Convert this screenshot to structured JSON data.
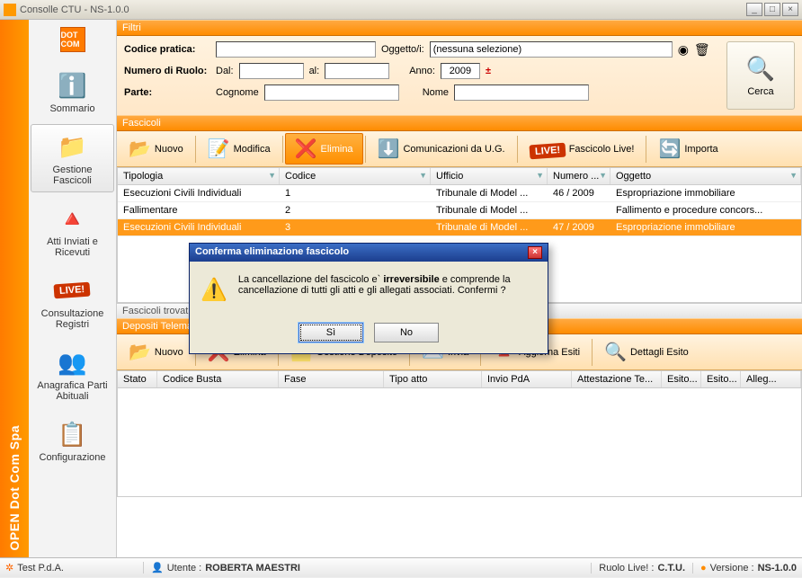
{
  "window": {
    "title": "Consolle CTU - NS-1.0.0"
  },
  "brand": {
    "vertical": "OPEN Dot Com Spa",
    "logo": "DOT COM"
  },
  "sidebar": {
    "items": [
      {
        "label": "Sommario",
        "icon": "ℹ️"
      },
      {
        "label": "Gestione Fascicoli",
        "icon": "📁"
      },
      {
        "label": "Atti Inviati e Ricevuti",
        "icon": "🔺"
      },
      {
        "label": "Consultazione Registri",
        "icon": "LIVE!"
      },
      {
        "label": "Anagrafica Parti Abituali",
        "icon": "👥"
      },
      {
        "label": "Configurazione",
        "icon": "📋"
      }
    ]
  },
  "filters": {
    "title": "Filtri",
    "codice_pratica_label": "Codice pratica:",
    "oggetto_label": "Oggetto/i:",
    "oggetto_value": "(nessuna selezione)",
    "numero_ruolo_label": "Numero di Ruolo:",
    "dal_label": "Dal:",
    "al_label": "al:",
    "anno_label": "Anno:",
    "anno_value": "2009",
    "parte_label": "Parte:",
    "cognome_label": "Cognome",
    "nome_label": "Nome",
    "cerca_label": "Cerca"
  },
  "fascicoli": {
    "title": "Fascicoli",
    "toolbar": [
      {
        "label": "Nuovo",
        "icon": "📂"
      },
      {
        "label": "Modifica",
        "icon": "📝"
      },
      {
        "label": "Elimina",
        "icon": "❌"
      },
      {
        "label": "Comunicazioni da U.G.",
        "icon": "⬇️"
      },
      {
        "label": "Fascicolo Live!",
        "icon": "LIVE!"
      },
      {
        "label": "Importa",
        "icon": "🔄"
      }
    ],
    "columns": [
      "Tipologia",
      "Codice",
      "Ufficio",
      "Numero ...",
      "Oggetto"
    ],
    "rows": [
      {
        "t": "Esecuzioni Civili Individuali",
        "c": "1",
        "u": "Tribunale di Model ...",
        "n": "46 / 2009",
        "o": "Espropriazione immobiliare"
      },
      {
        "t": "Fallimentare",
        "c": "2",
        "u": "Tribunale di Model ...",
        "n": "",
        "o": "Fallimento e procedure concors..."
      },
      {
        "t": "Esecuzioni Civili Individuali",
        "c": "3",
        "u": "Tribunale di Model ...",
        "n": "47 / 2009",
        "o": "Espropriazione immobiliare"
      }
    ],
    "count_label": "Fascicoli trovati :"
  },
  "depositi": {
    "title": "Depositi Telematici",
    "toolbar": [
      {
        "label": "Nuovo",
        "icon": "📂"
      },
      {
        "label": "Elimina",
        "icon": "❌"
      },
      {
        "label": "Gestione Deposito",
        "icon": "🗂️"
      },
      {
        "label": "Invia",
        "icon": "✉️"
      },
      {
        "label": "Aggiorna Esiti",
        "icon": "🔺"
      },
      {
        "label": "Dettagli Esito",
        "icon": "🔍"
      }
    ],
    "columns": [
      "Stato",
      "Codice Busta",
      "Fase",
      "Tipo atto",
      "Invio PdA",
      "Attestazione Te...",
      "Esito...",
      "Esito...",
      "Alleg..."
    ]
  },
  "dialog": {
    "title": "Conferma eliminazione fascicolo",
    "msg_pre": "La cancellazione del fascicolo e` ",
    "msg_bold": "irreversibile",
    "msg_post": " e comprende la cancellazione di tutti gli atti e gli allegati associati. Confermi ?",
    "yes": "Sì",
    "no": "No"
  },
  "statusbar": {
    "test": "Test P.d.A.",
    "utente_label": "Utente : ",
    "utente_value": "ROBERTA MAESTRI",
    "ruolo_label": "Ruolo Live! : ",
    "ruolo_value": "C.T.U.",
    "versione_label": "Versione : ",
    "versione_value": "NS-1.0.0"
  }
}
